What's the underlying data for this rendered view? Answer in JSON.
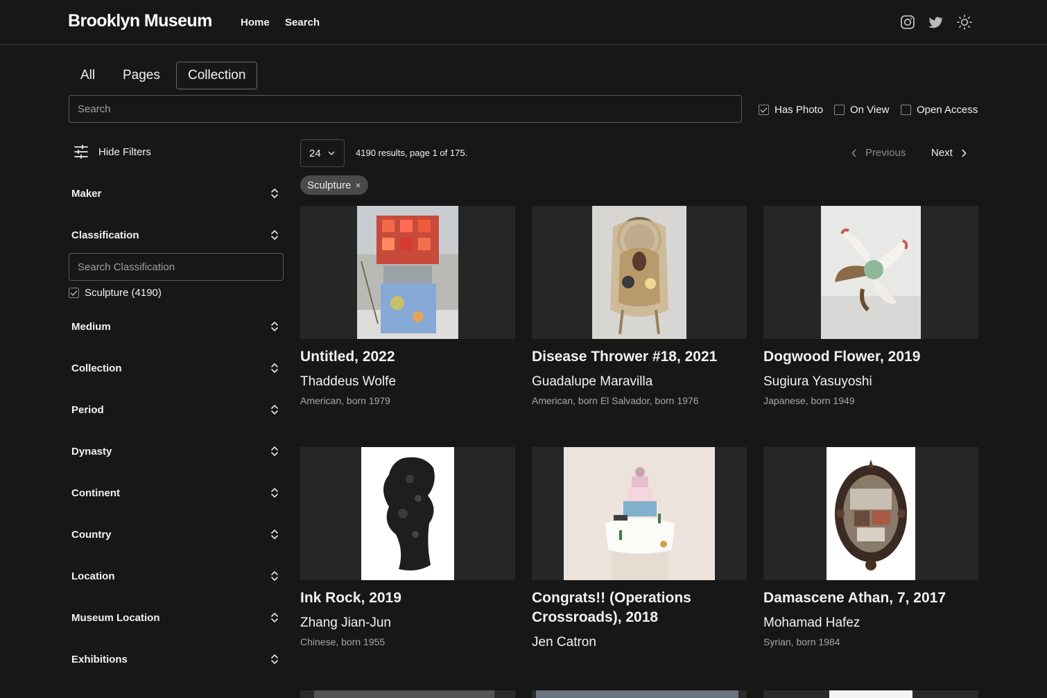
{
  "header": {
    "logo": "Brooklyn Museum",
    "nav": [
      {
        "label": "Home"
      },
      {
        "label": "Search"
      }
    ],
    "icons": [
      "instagram-icon",
      "twitter-icon",
      "theme-toggle-sun-icon"
    ]
  },
  "tabs": [
    {
      "label": "All",
      "active": false
    },
    {
      "label": "Pages",
      "active": false
    },
    {
      "label": "Collection",
      "active": true
    }
  ],
  "search": {
    "placeholder": "Search",
    "value": ""
  },
  "filters_top": [
    {
      "label": "Has Photo",
      "checked": true
    },
    {
      "label": "On View",
      "checked": false
    },
    {
      "label": "Open Access",
      "checked": false
    }
  ],
  "sidebar": {
    "hide_filters_label": "Hide Filters",
    "facets": [
      {
        "label": "Maker"
      },
      {
        "label": "Classification"
      },
      {
        "label": "Medium"
      },
      {
        "label": "Collection"
      },
      {
        "label": "Period"
      },
      {
        "label": "Dynasty"
      },
      {
        "label": "Continent"
      },
      {
        "label": "Country"
      },
      {
        "label": "Location"
      },
      {
        "label": "Museum Location"
      },
      {
        "label": "Exhibitions"
      }
    ],
    "classification_search_placeholder": "Search Classification",
    "classification_options": [
      {
        "label": "Sculpture (4190)",
        "checked": true
      }
    ]
  },
  "results": {
    "per_page": "24",
    "summary": "4190 results, page 1 of 175.",
    "prev_label": "Previous",
    "next_label": "Next",
    "active_filter_chip": "Sculpture",
    "chip_remove": "×",
    "cards": [
      {
        "title": "Untitled, 2022",
        "maker": "Thaddeus Wolfe",
        "bio": "American, born 1979"
      },
      {
        "title": "Disease Thrower #18, 2021",
        "maker": "Guadalupe Maravilla",
        "bio": "American, born El Salvador, born 1976"
      },
      {
        "title": "Dogwood Flower, 2019",
        "maker": "Sugiura Yasuyoshi",
        "bio": "Japanese, born 1949"
      },
      {
        "title": "Ink Rock, 2019",
        "maker": "Zhang Jian-Jun",
        "bio": "Chinese, born 1955"
      },
      {
        "title": "Congrats!! (Operations Crossroads), 2018",
        "maker": "Jen Catron",
        "bio": ""
      },
      {
        "title": "Damascene Athan, 7, 2017",
        "maker": "Mohamad Hafez",
        "bio": "Syrian, born 1984"
      }
    ]
  },
  "colors": {
    "background": "#171717",
    "text": "#f2f2f2",
    "muted": "#a8a8a8",
    "chip": "#4a4a4a",
    "card_bg": "#262626"
  }
}
